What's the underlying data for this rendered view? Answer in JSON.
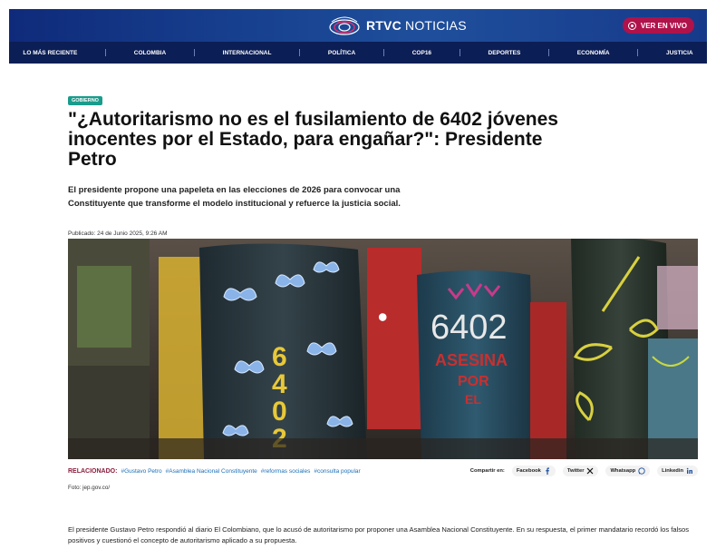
{
  "header": {
    "brand_bold": "RTVC",
    "brand_rest": " NOTICIAS",
    "live_label": "VER EN VIVO"
  },
  "nav": {
    "items": [
      "LO MÁS RECIENTE",
      "COLOMBIA",
      "INTERNACIONAL",
      "POLÍTICA",
      "COP16",
      "DEPORTES",
      "ECONOMÍA",
      "JUSTICIA"
    ]
  },
  "article": {
    "category": "GOBIERNO",
    "title": "\"¿Autoritarismo no es el fusilamiento de 6402 jóvenes inocentes por el Estado, para engañar?\": Presidente Petro",
    "subtitle": "El presidente propone una papeleta en las elecciones de 2026 para convocar una Constituyente que transforme el modelo institucional y refuerce la justicia social.",
    "published": "Publicado: 24 de Junio 2025, 9:26 AM",
    "photo_credit": "Foto: jep.gov.co/",
    "body": "El presidente Gustavo Petro respondió al diario El Colombiano, que lo acusó de autoritarismo por proponer una Asamblea Nacional Constituyente. En su respuesta, el primer mandatario recordó los falsos positivos y cuestionó el concepto de autoritarismo aplicado a su propuesta."
  },
  "hero_text": {
    "boot_number": "6402",
    "boot_text_1": "ASESINA",
    "boot_text_2": "POR",
    "boot_text_3": "EL",
    "vertical_digits": [
      "6",
      "4",
      "0",
      "2"
    ]
  },
  "related": {
    "label": "RELACIONADO:",
    "tags": [
      "#Gustavo Petro",
      "#Asamblea Nacional Constituyente",
      "#reformas sociales",
      "#consulta popular"
    ]
  },
  "share": {
    "label": "Compartir en:",
    "buttons": [
      {
        "label": "Facebook",
        "icon": "facebook-icon"
      },
      {
        "label": "Twitter",
        "icon": "x-icon"
      },
      {
        "label": "Whatsapp",
        "icon": "whatsapp-icon"
      },
      {
        "label": "Linkedin",
        "icon": "linkedin-icon"
      }
    ]
  },
  "colors": {
    "header_blue": "#17418f",
    "nav_dark": "#0b1e55",
    "live_red": "#b0124a",
    "tag_teal": "#1a9c8c",
    "related_label": "#8a1c3c",
    "link_blue": "#1a6fb8"
  }
}
